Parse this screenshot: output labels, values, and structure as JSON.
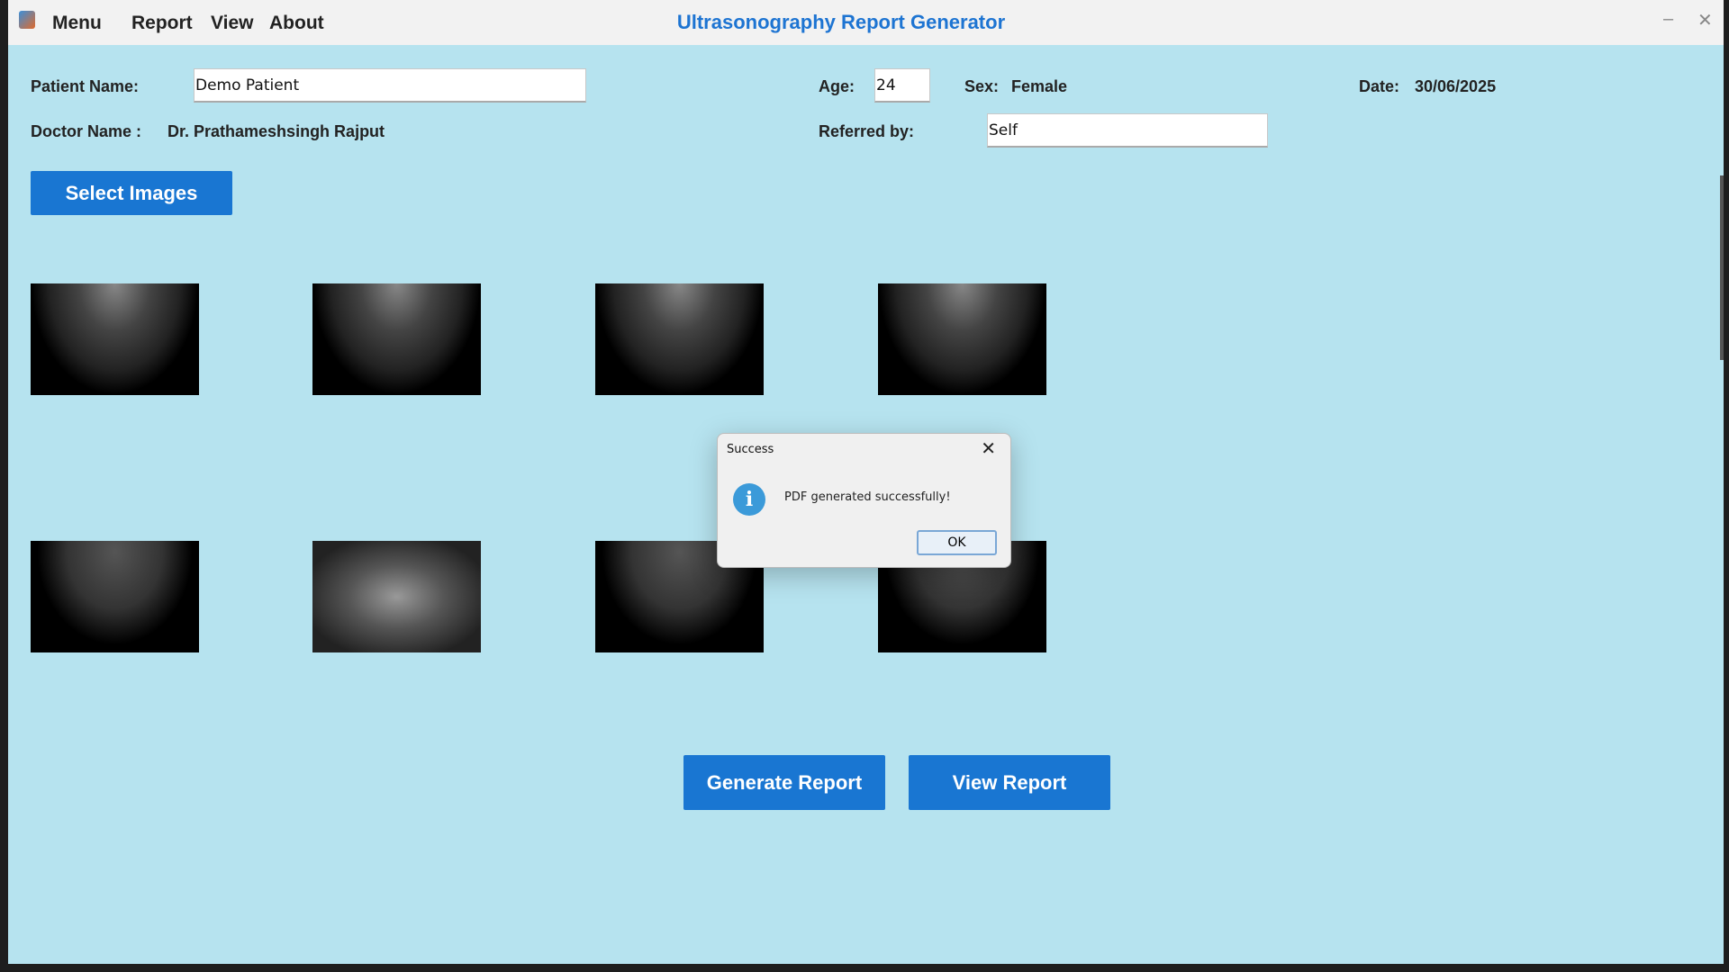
{
  "app": {
    "title": "Ultrasonography Report Generator",
    "menu": [
      "Menu",
      "Report",
      "View",
      "About"
    ]
  },
  "form": {
    "patient_name_label": "Patient Name:",
    "patient_name": "Demo Patient",
    "age_label": "Age:",
    "age": "24",
    "sex_label": "Sex:",
    "sex": "Female",
    "date_label": "Date:",
    "date": "30/06/2025",
    "doctor_label": "Doctor Name :",
    "doctor": "Dr. Prathameshsingh Rajput",
    "referred_label": "Referred by:",
    "referred": "Self"
  },
  "buttons": {
    "select_images": "Select Images",
    "generate_report": "Generate Report",
    "view_report": "View Report"
  },
  "images": {
    "count": 8
  },
  "dialog": {
    "title": "Success",
    "message": "PDF generated successfully!",
    "ok": "OK",
    "icon": "info-icon"
  },
  "colors": {
    "background": "#b6e3ef",
    "accent": "#1976d2",
    "title": "#1d74d2"
  }
}
